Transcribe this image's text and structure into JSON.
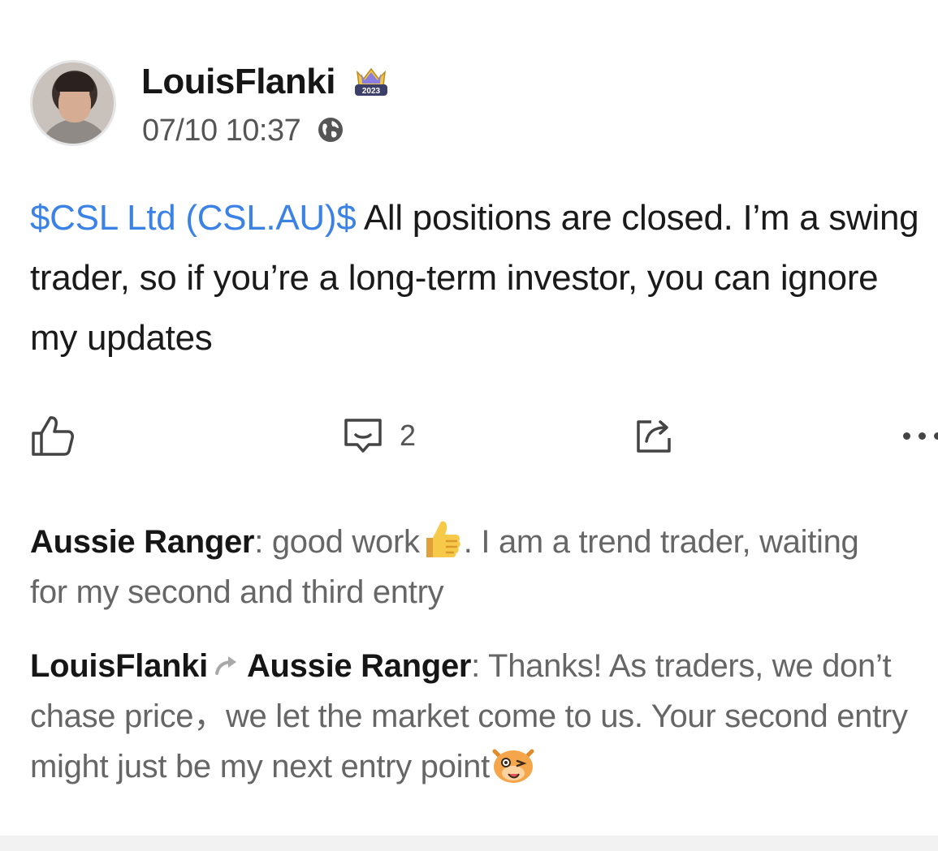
{
  "post": {
    "username": "LouisFlanki",
    "badge_year": "2023",
    "timestamp": "07/10 10:37",
    "ticker": "$CSL Ltd (CSL.AU)$",
    "text": " All positions are closed. I’m a swing trader, so if you’re a long-term investor, you can ignore my updates",
    "comment_count": "2"
  },
  "icons": {
    "visibility": "globe-icon",
    "like": "thumbs-up-icon",
    "comment": "comment-icon",
    "share": "share-icon",
    "more": "more-icon"
  },
  "colors": {
    "ticker": "#3b82e6",
    "author": "#161616",
    "comment_text": "#666666"
  },
  "comments": [
    {
      "author": "Aussie Ranger",
      "text_before_emoji": ": good work",
      "emoji": "thumbs-up-emoji",
      "text_after_emoji": ".  I am a trend trader, waiting",
      "line2": "for my second and third entry"
    },
    {
      "author": "LouisFlanki",
      "reply_to": "Aussie Ranger",
      "text": ": Thanks! As traders, we don’t chase price，we let the market come to us. Your second entry might just be my next entry point",
      "emoji": "wink-cow-emoji"
    }
  ]
}
